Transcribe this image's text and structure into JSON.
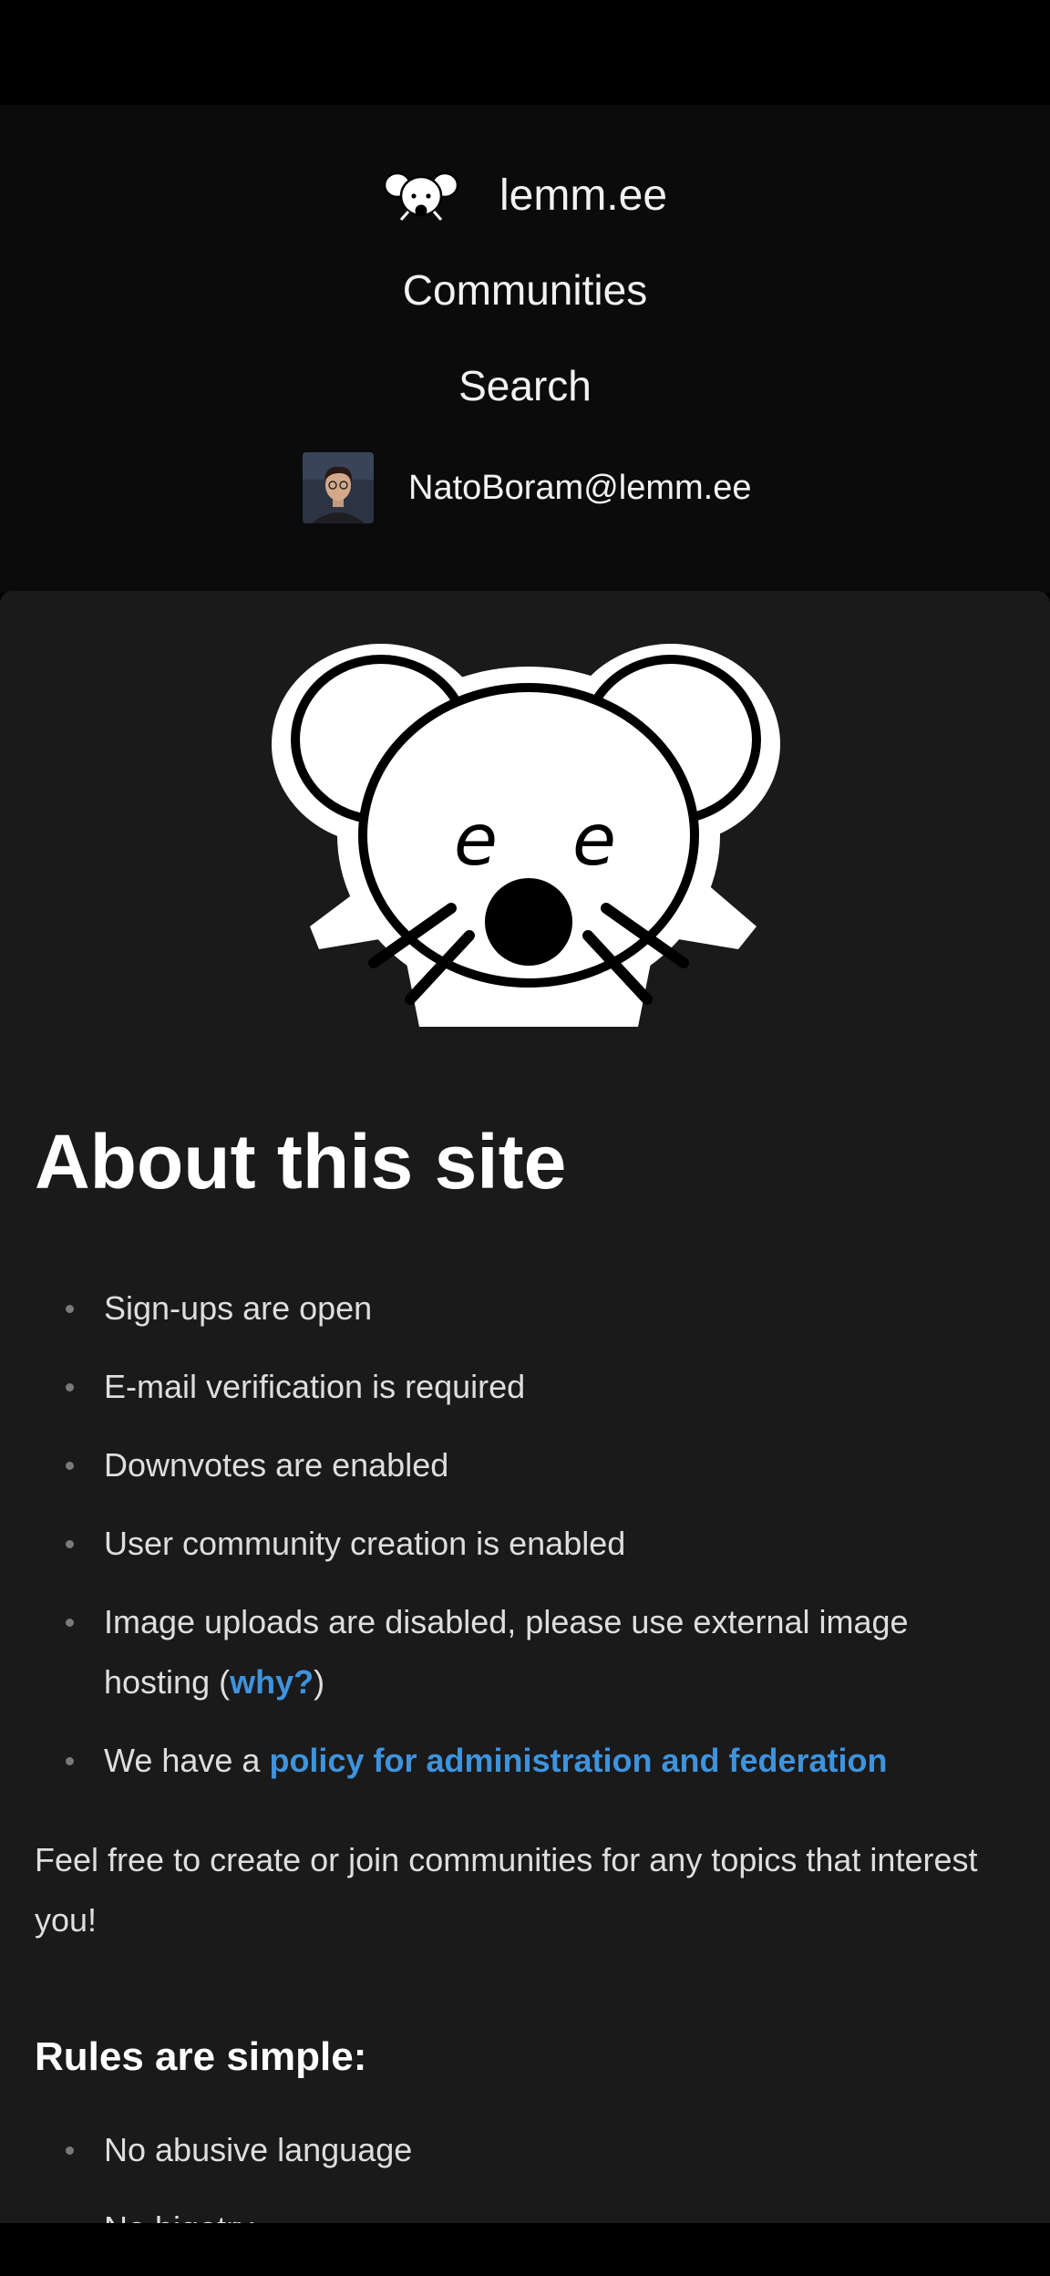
{
  "header": {
    "site_name": "lemm.ee",
    "nav": [
      {
        "label": "Communities"
      },
      {
        "label": "Search"
      }
    ],
    "user": {
      "name": "NatoBoram@lemm.ee"
    }
  },
  "about": {
    "title": "About this site",
    "items": [
      {
        "text": "Sign-ups are open"
      },
      {
        "text": "E-mail verification is required"
      },
      {
        "text": "Downvotes are enabled"
      },
      {
        "text": "User community creation is enabled"
      },
      {
        "text": "Image uploads are disabled, please use external image hosting (",
        "link": "why?",
        "suffix": ")"
      },
      {
        "text": "We have a ",
        "link": "policy for administration and federation"
      }
    ],
    "paragraph": "Feel free to create or join communities for any topics that interest you!"
  },
  "rules": {
    "title": "Rules are simple:",
    "items": [
      {
        "text": "No abusive language"
      },
      {
        "text": "No bigotry"
      }
    ]
  },
  "colors": {
    "background": "#1a1a1b",
    "nav_background": "#0b0b0b",
    "link": "#3f93dc"
  },
  "icons": {
    "brand": "lemmee-mouse-logo",
    "hero": "lemmee-mouse-logo-large",
    "avatar": "user-avatar"
  }
}
